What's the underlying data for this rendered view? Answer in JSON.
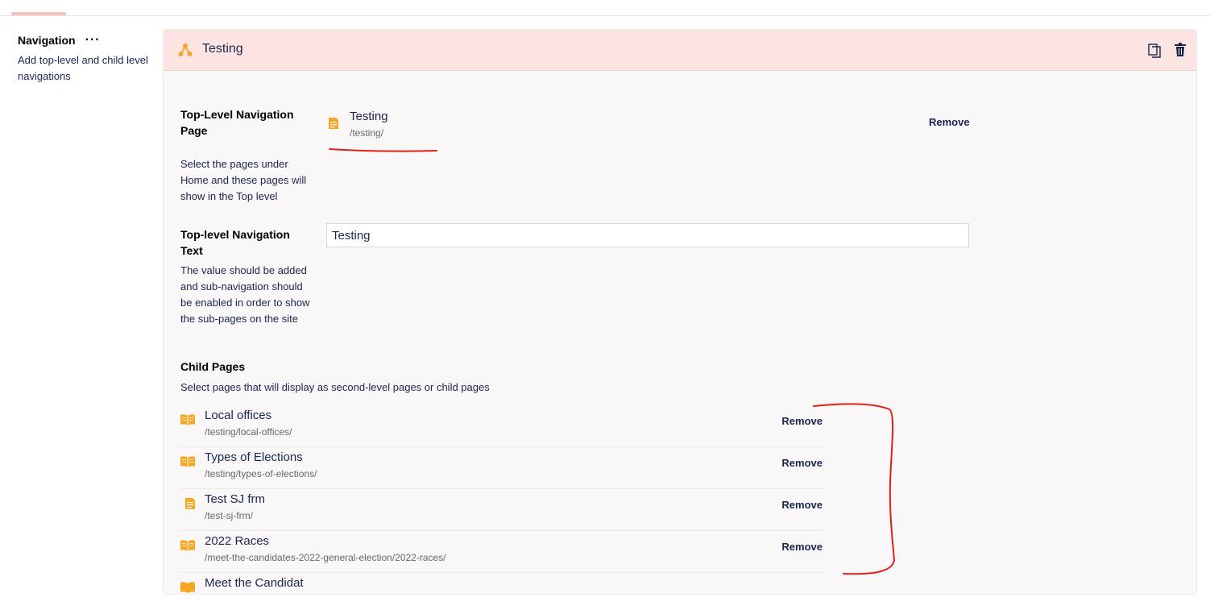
{
  "section": {
    "title": "Navigation",
    "description": "Add top-level and child level navigations"
  },
  "block": {
    "title": "Testing"
  },
  "top_level_page": {
    "label": "Top-Level Navigation Page",
    "hint": "Select the pages under Home and these pages will show in the Top level",
    "selected_name": "Testing",
    "selected_url": "/testing/",
    "remove_label": "Remove"
  },
  "top_level_text": {
    "label": "Top-level Navigation Text",
    "hint": "The value should be added and sub-navigation should be enabled in order to show the sub-pages on the site",
    "value": "Testing"
  },
  "child_pages": {
    "label": "Child Pages",
    "hint": "Select pages that will display as second-level pages or child pages",
    "items": [
      {
        "name": "Local offices",
        "url": "/testing/local-offices/",
        "icon": "book-icon",
        "remove_label": "Remove"
      },
      {
        "name": "Types of Elections",
        "url": "/testing/types-of-elections/",
        "icon": "book-icon",
        "remove_label": "Remove"
      },
      {
        "name": "Test SJ frm",
        "url": "/test-sj-frm/",
        "icon": "document-icon",
        "remove_label": "Remove"
      },
      {
        "name": "2022 Races",
        "url": "/meet-the-candidates-2022-general-election/2022-races/",
        "icon": "book-icon",
        "remove_label": "Remove"
      },
      {
        "name": "Meet the Candidat",
        "url": "",
        "icon": "book-icon",
        "remove_label": ""
      }
    ]
  },
  "colors": {
    "accent": "#f5a623",
    "header_bg": "#fbe4e2",
    "annotation": "#e0201b",
    "text": "#1b264f"
  }
}
